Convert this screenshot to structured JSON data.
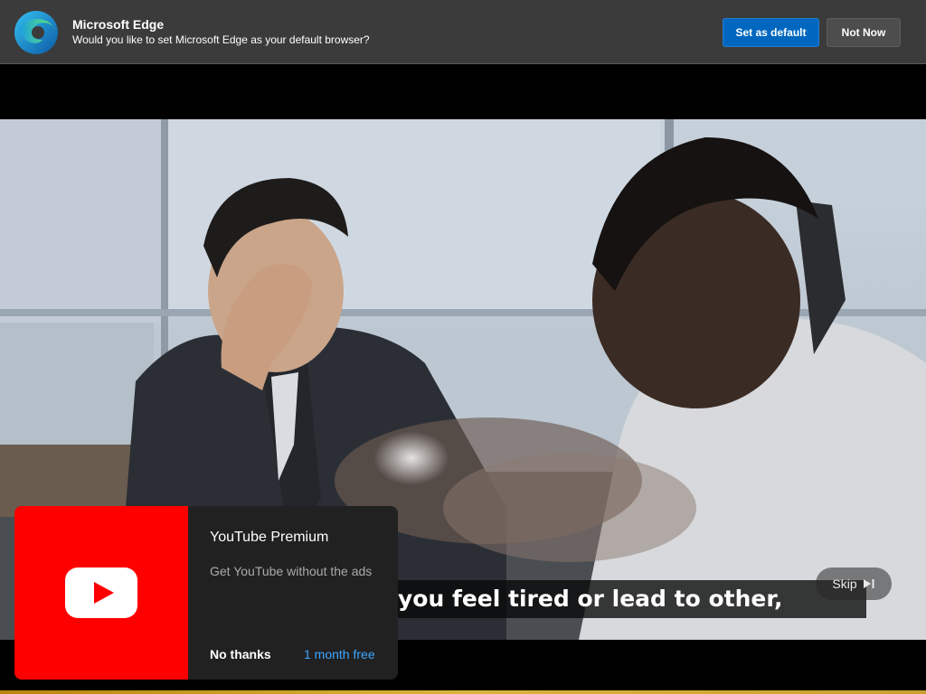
{
  "banner": {
    "title": "Microsoft Edge",
    "message": "Would you like to set Microsoft Edge as your default browser?",
    "primary_button": "Set as default",
    "secondary_button": "Not Now",
    "logo_icon": "edge-logo-icon",
    "accent_color": "#0067c0"
  },
  "video": {
    "caption": "you feel tired or lead to other,",
    "skip_label": "Skip",
    "skip_icon": "skip-next-icon"
  },
  "promo": {
    "title": "YouTube Premium",
    "subtitle": "Get YouTube without the ads",
    "dismiss_label": "No thanks",
    "cta_label": "1 month free",
    "logo_icon": "youtube-logo-icon",
    "brand_color": "#ff0000",
    "cta_color": "#3ea6ff"
  }
}
